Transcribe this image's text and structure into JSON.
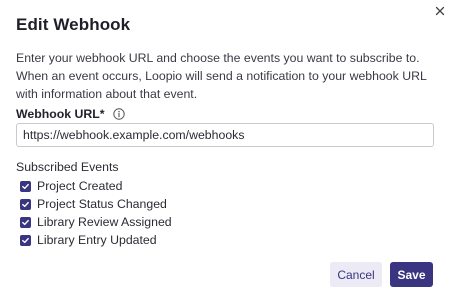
{
  "dialog": {
    "title": "Edit Webhook",
    "description": "Enter your webhook URL and choose the events you want to subscribe to. When an event occurs, Loopio will send a notification to your webhook URL with information about that event."
  },
  "url_field": {
    "label": "Webhook URL*",
    "value": "https://webhook.example.com/webhooks"
  },
  "events": {
    "label": "Subscribed Events",
    "items": [
      {
        "label": "Project Created",
        "checked": true
      },
      {
        "label": "Project Status Changed",
        "checked": true
      },
      {
        "label": "Library Review Assigned",
        "checked": true
      },
      {
        "label": "Library Entry Updated",
        "checked": true
      }
    ]
  },
  "buttons": {
    "cancel": "Cancel",
    "save": "Save"
  },
  "icons": {
    "close": "close-icon",
    "info": "info-icon",
    "check": "checkmark-icon"
  },
  "colors": {
    "accent": "#3a3580",
    "cancel_bg": "#ebeaf5",
    "border": "#c9c9d1"
  }
}
